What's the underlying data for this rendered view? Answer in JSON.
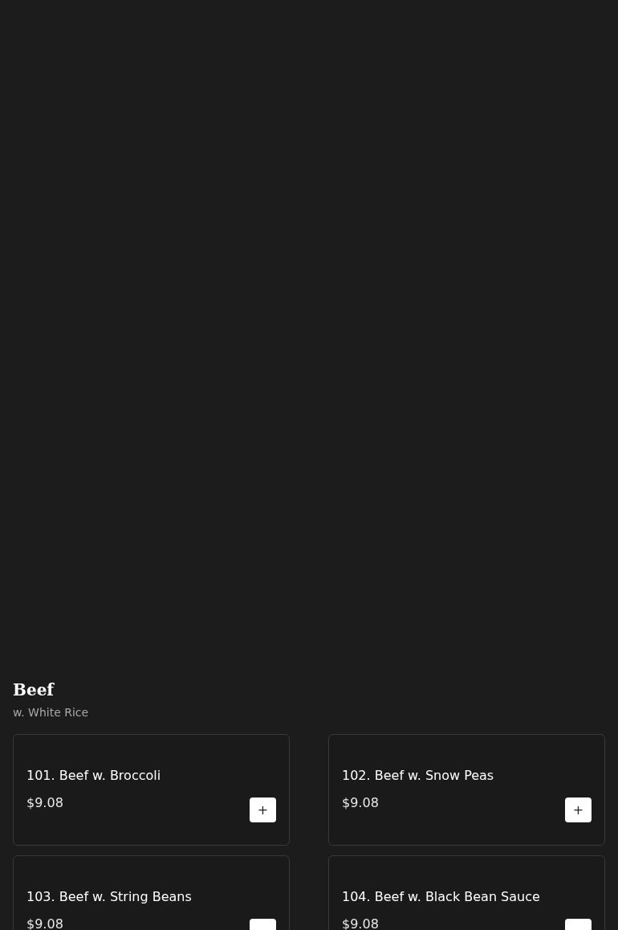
{
  "section": {
    "title": "Beef",
    "subtitle": "w. White Rice"
  },
  "items": [
    {
      "name": "101. Beef w. Broccoli",
      "price": "$9.08",
      "add_label": "+"
    },
    {
      "name": "102. Beef w. Snow Peas",
      "price": "$9.08",
      "add_label": "+"
    },
    {
      "name": "103. Beef w. String Beans",
      "price": "$9.08"
    },
    {
      "name": "104. Beef w. Black Bean Sauce",
      "price": "$9.08"
    }
  ]
}
